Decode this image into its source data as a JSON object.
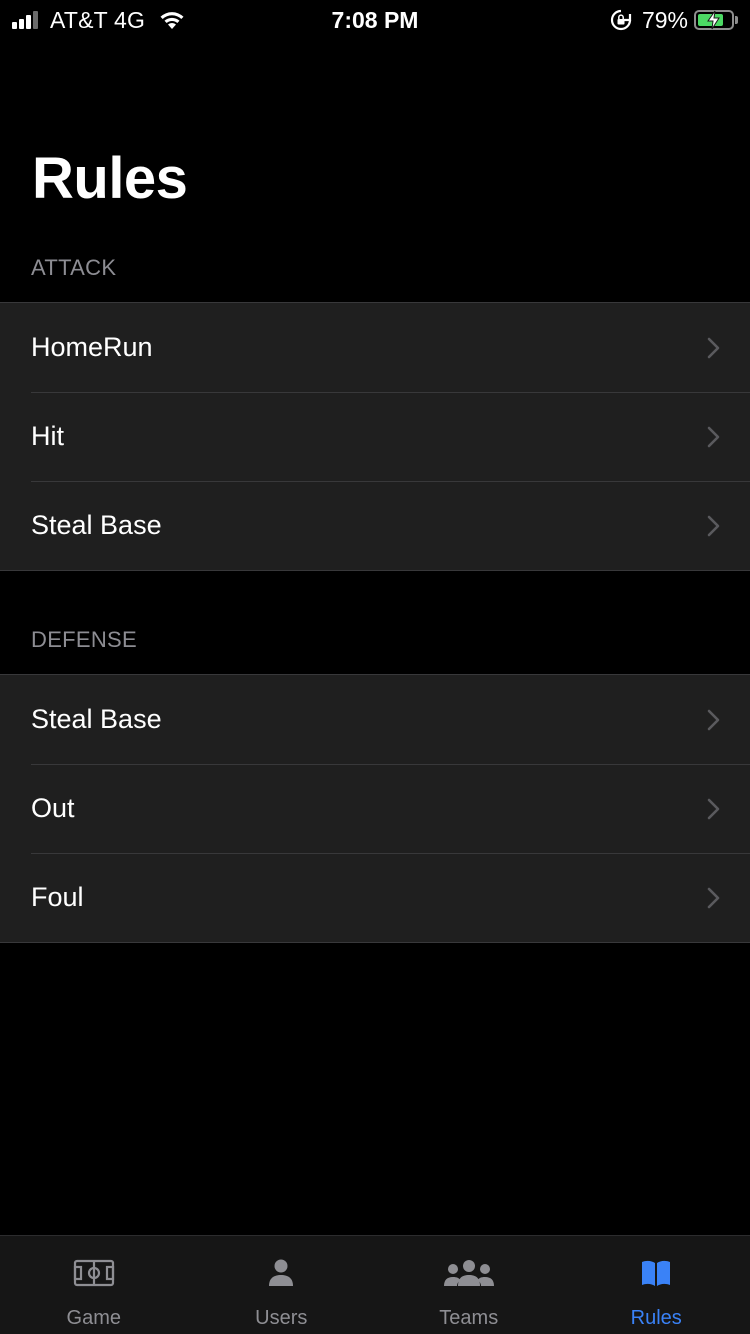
{
  "status_bar": {
    "carrier": "AT&T 4G",
    "time": "7:08 PM",
    "battery_percent": "79%",
    "battery_level": 0.79,
    "signal_bars": 4,
    "signal_bars_filled": 3,
    "battery_fill_color": "#4cd964",
    "icons": [
      "signal-icon",
      "wifi-icon",
      "rotation-lock-icon",
      "battery-charging-icon"
    ]
  },
  "header": {
    "title": "Rules"
  },
  "sections": [
    {
      "header": "ATTACK",
      "items": [
        {
          "label": "HomeRun"
        },
        {
          "label": "Hit"
        },
        {
          "label": "Steal Base"
        }
      ]
    },
    {
      "header": "DEFENSE",
      "items": [
        {
          "label": "Steal Base"
        },
        {
          "label": "Out"
        },
        {
          "label": "Foul"
        }
      ]
    }
  ],
  "tab_bar": {
    "active_color": "#3a82f7",
    "inactive_color": "#8e8e93",
    "tabs": [
      {
        "label": "Game",
        "icon": "field-icon",
        "active": false
      },
      {
        "label": "Users",
        "icon": "person-icon",
        "active": false
      },
      {
        "label": "Teams",
        "icon": "group-icon",
        "active": false
      },
      {
        "label": "Rules",
        "icon": "book-icon",
        "active": true
      }
    ]
  }
}
